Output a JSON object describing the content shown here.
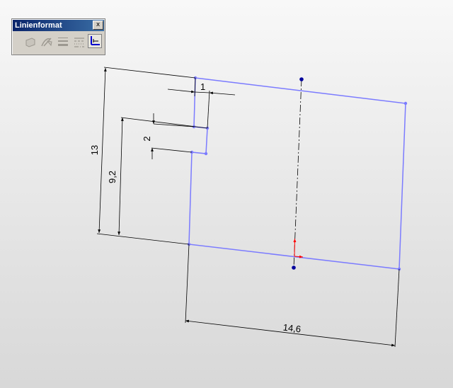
{
  "toolbar": {
    "title": "Linienformat",
    "close_symbol": "x",
    "buttons": [
      {
        "icon": "line-color-icon",
        "enabled": false
      },
      {
        "icon": "line-thickness-icon",
        "enabled": false
      },
      {
        "icon": "line-width-icon",
        "enabled": false
      },
      {
        "icon": "line-style-icon",
        "enabled": false
      },
      {
        "icon": "line-display-icon",
        "enabled": true
      }
    ]
  },
  "dimensions": {
    "width_top": "1",
    "notch_height": "2",
    "overall_height": "13",
    "left_height": "9,2",
    "bottom_width": "14,6"
  },
  "colors": {
    "sketch": "#7b7bff",
    "dimension": "#000000",
    "centerline_point": "#00009c",
    "origin_axis": "#ff0000"
  }
}
